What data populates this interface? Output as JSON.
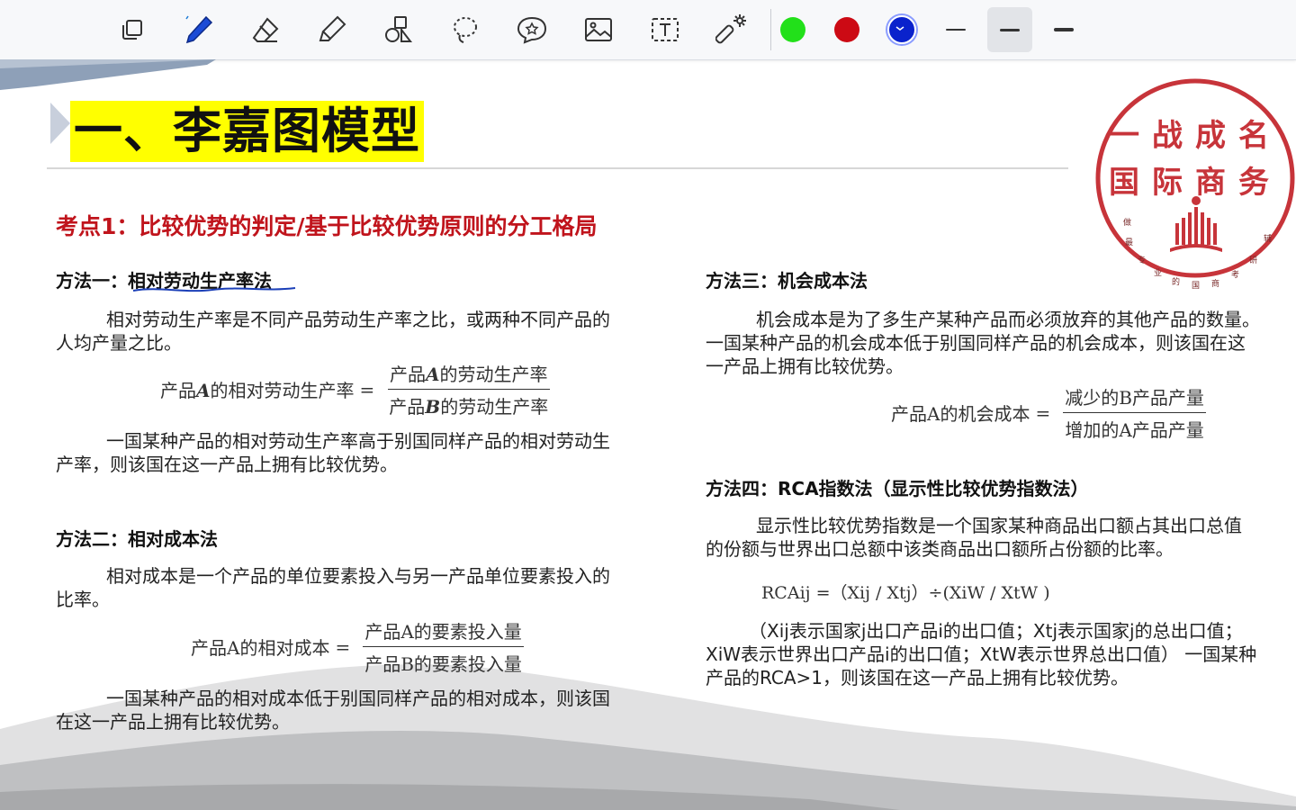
{
  "toolbar": {
    "tools": [
      {
        "name": "select-tool",
        "icon": "layers-icon"
      },
      {
        "name": "pen-tool",
        "icon": "pen-icon"
      },
      {
        "name": "eraser-tool",
        "icon": "eraser-icon"
      },
      {
        "name": "highlighter-tool",
        "icon": "highlighter-icon"
      },
      {
        "name": "shapes-tool",
        "icon": "shapes-icon"
      },
      {
        "name": "lasso-tool",
        "icon": "lasso-icon"
      },
      {
        "name": "sticker-tool",
        "icon": "star-bubble-icon"
      },
      {
        "name": "image-tool",
        "icon": "image-icon"
      },
      {
        "name": "text-tool",
        "icon": "text-box-icon"
      },
      {
        "name": "laser-tool",
        "icon": "laser-pointer-icon"
      }
    ],
    "colors": {
      "green": "#22e01a",
      "red": "#cc0a14",
      "blue": "#0a22cc"
    },
    "selected_color": "blue",
    "stroke_widths_selected_index": 1
  },
  "slide": {
    "title": "一、李嘉图模型",
    "heading": "考点1：比较优势的判定/基于比较优势原则的分工格局",
    "method1": {
      "label": "方法一：",
      "name": "相对劳动生产率法",
      "para1_line1": "相对劳动生产率是不同产品劳动生产率之比，或两种不同产品的",
      "para1_line2": "人均产量之比。",
      "formula_lhs_pre": "产品",
      "formula_lhs_var": "A",
      "formula_lhs_post": "的相对劳动生产率",
      "formula_num_pre": "产品",
      "formula_num_var": "A",
      "formula_num_post": "的劳动生产率",
      "formula_den_pre": "产品",
      "formula_den_var": "B",
      "formula_den_post": "的劳动生产率",
      "para2_line1": "一国某种产品的相对劳动生产率高于别国同样产品的相对劳动生",
      "para2_line2": "产率，则该国在这一产品上拥有比较优势。"
    },
    "method2": {
      "label": "方法二：相对成本法",
      "para1_line1": "相对成本是一个产品的单位要素投入与另一产品单位要素投入的",
      "para1_line2": "比率。",
      "formula_lhs": "产品A的相对成本",
      "formula_num": "产品A的要素投入量",
      "formula_den": "产品B的要素投入量",
      "para2_line1": "一国某种产品的相对成本低于别国同样产品的相对成本，则该国",
      "para2_line2": "在这一产品上拥有比较优势。"
    },
    "method3": {
      "label": "方法三：机会成本法",
      "para_line1": "机会成本是为了多生产某种产品而必须放弃的其他产品的数量。",
      "para_line2": "一国某种产品的机会成本低于别国同样产品的机会成本，则该国在这",
      "para_line3": "一产品上拥有比较优势。",
      "formula_lhs": "产品A的机会成本",
      "formula_num": "减少的B产品产量",
      "formula_den": "增加的A产品产量"
    },
    "method4": {
      "label": "方法四：RCA指数法（显示性比较优势指数法）",
      "para_line1": "显示性比较优势指数是一个国家某种商品出口额占其出口总值",
      "para_line2": "的份额与世界出口总额中该类商品出口额所占份额的比率。",
      "rca_formula_text": "RCAij =（Xij / Xtj）÷(XiW / XtW )",
      "note_line1": "（Xij表示国家j出口产品i的出口值；Xtj表示国家j的总出口值；",
      "note_line2": "XiW表示世界出口产品i的出口值；XtW表示世界总出口值）  一国某种",
      "note_line3": "产品的RCA>1，则该国在这一产品上拥有比较优势。"
    },
    "stamp": {
      "line1": "一战成名",
      "line2": "国际商务",
      "ring_text": "做最专业的国商考研辅"
    }
  }
}
